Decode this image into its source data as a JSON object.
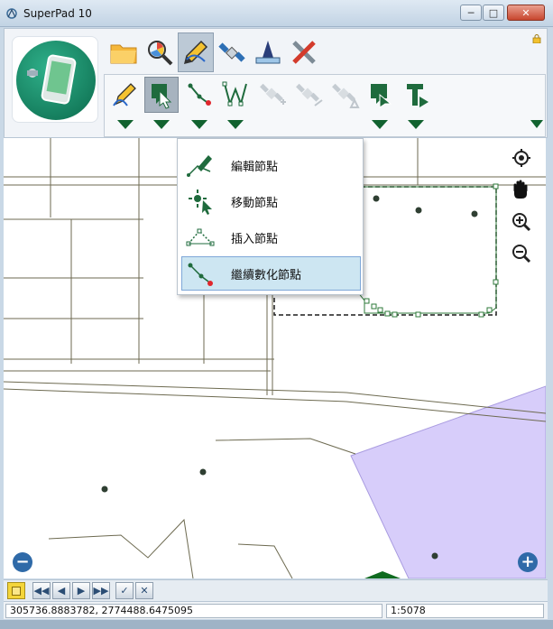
{
  "window": {
    "title": "SuperPad 10"
  },
  "toolbar": {
    "main_tools": [
      {
        "name": "open-folder-icon"
      },
      {
        "name": "identify-search-icon"
      },
      {
        "name": "edit-pencil-icon",
        "active": true
      },
      {
        "name": "gps-satellite-icon"
      },
      {
        "name": "measure-ruler-icon"
      },
      {
        "name": "tools-wrench-icon"
      }
    ],
    "edit_tools": [
      {
        "name": "edit-feature-icon"
      },
      {
        "name": "select-feature-icon",
        "active": true
      },
      {
        "name": "node-edit-icon"
      },
      {
        "name": "vertex-edit-icon"
      },
      {
        "name": "gps-add-point-icon",
        "disabled": true
      },
      {
        "name": "gps-add-line-icon",
        "disabled": true
      },
      {
        "name": "gps-add-polygon-icon",
        "disabled": true
      },
      {
        "name": "attribute-select-icon"
      },
      {
        "name": "text-label-icon"
      }
    ]
  },
  "dropdown": {
    "items": [
      {
        "label": "編輯節點",
        "icon": "edit-node-icon"
      },
      {
        "label": "移動節點",
        "icon": "move-node-icon"
      },
      {
        "label": "插入節點",
        "icon": "insert-node-icon"
      },
      {
        "label": "繼續數化節點",
        "icon": "continue-digitize-icon",
        "selected": true
      }
    ]
  },
  "status": {
    "coordinates": "305736.8883782, 2774488.6475095",
    "scale": "1:5078"
  },
  "colors": {
    "accent_green": "#11622f",
    "polygon_fill": "#d7cdfa",
    "selection_blue": "#cde6f2"
  }
}
